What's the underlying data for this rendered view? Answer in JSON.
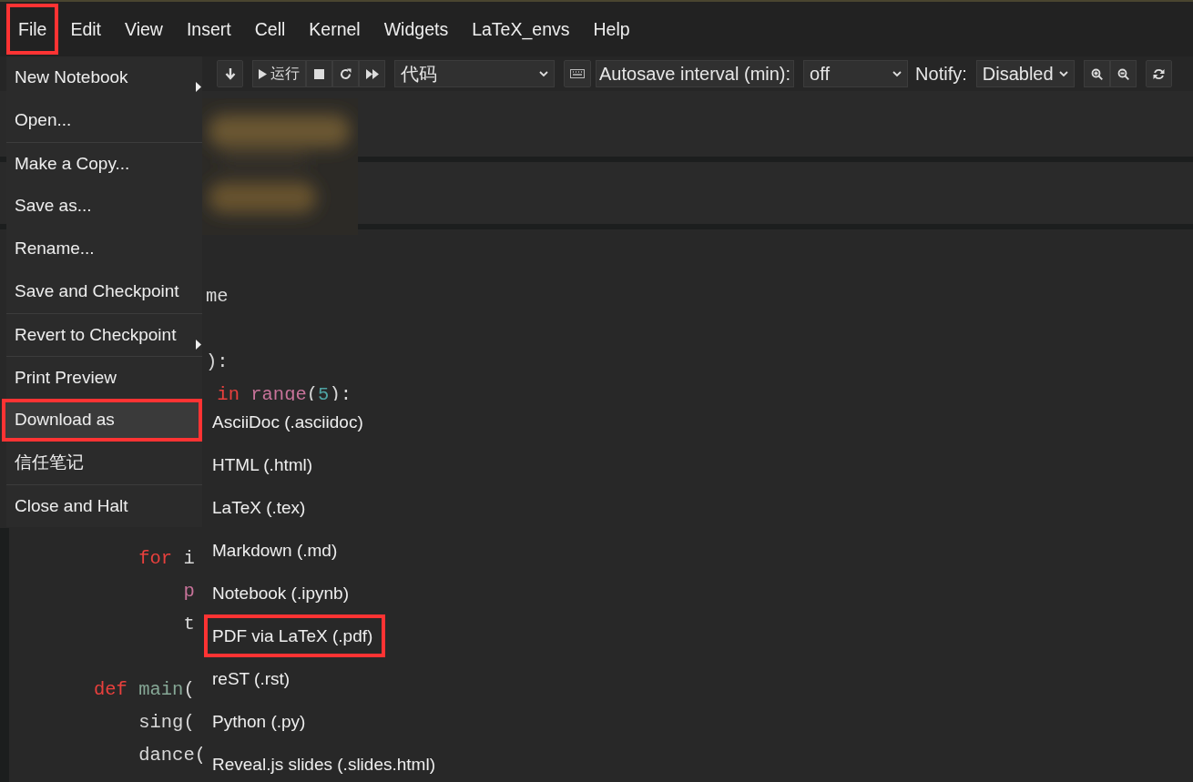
{
  "menubar": {
    "items": [
      {
        "label": "File",
        "highlighted": true
      },
      {
        "label": "Edit",
        "highlighted": false
      },
      {
        "label": "View",
        "highlighted": false
      },
      {
        "label": "Insert",
        "highlighted": false
      },
      {
        "label": "Cell",
        "highlighted": false
      },
      {
        "label": "Kernel",
        "highlighted": false
      },
      {
        "label": "Widgets",
        "highlighted": false
      },
      {
        "label": "LaTeX_envs",
        "highlighted": false
      },
      {
        "label": "Help",
        "highlighted": false
      }
    ]
  },
  "toolbar": {
    "run_label": "运行",
    "cell_type": "代码",
    "autosave_label": "Autosave interval (min):",
    "autosave_value": "off",
    "notify_label": "Notify:",
    "notify_value": "Disabled"
  },
  "code_lines": [
    {
      "kind": "code",
      "tokens": [
        {
          "kind": "plain",
          "text": "          me"
        }
      ]
    },
    {
      "kind": "blank"
    },
    {
      "kind": "code",
      "tokens": [
        {
          "kind": "plain",
          "text": "          ):"
        }
      ]
    },
    {
      "kind": "code",
      "tokens": [
        {
          "kind": "keyword",
          "text": "           in "
        },
        {
          "kind": "builtin",
          "text": "range"
        },
        {
          "kind": "plain",
          "text": "("
        },
        {
          "kind": "number",
          "text": "5"
        },
        {
          "kind": "plain",
          "text": "):"
        }
      ]
    },
    {
      "kind": "blank"
    },
    {
      "kind": "blank"
    },
    {
      "kind": "blank"
    },
    {
      "kind": "blank"
    },
    {
      "kind": "code",
      "tokens": [
        {
          "kind": "keyword",
          "text": "    for"
        },
        {
          "kind": "plain",
          "text": " i"
        }
      ]
    },
    {
      "kind": "code",
      "tokens": [
        {
          "kind": "builtin",
          "text": "        p"
        }
      ]
    },
    {
      "kind": "code",
      "tokens": [
        {
          "kind": "plain",
          "text": "        t"
        }
      ]
    },
    {
      "kind": "blank"
    },
    {
      "kind": "code",
      "tokens": [
        {
          "kind": "keyword",
          "text": "def "
        },
        {
          "kind": "defname",
          "text": "main"
        },
        {
          "kind": "plain",
          "text": "("
        }
      ]
    },
    {
      "kind": "code",
      "tokens": [
        {
          "kind": "plain",
          "text": "    sing("
        }
      ]
    },
    {
      "kind": "code",
      "tokens": [
        {
          "kind": "plain",
          "text": "    dance("
        }
      ]
    }
  ],
  "file_menu": {
    "items": [
      {
        "label": "New Notebook",
        "arrow": true,
        "separator_before": false,
        "hovered": false,
        "highlighted": false
      },
      {
        "label": "Open...",
        "arrow": false,
        "separator_before": false,
        "hovered": false,
        "highlighted": false
      },
      {
        "label": "Make a Copy...",
        "arrow": false,
        "separator_before": true,
        "hovered": false,
        "highlighted": false
      },
      {
        "label": "Save as...",
        "arrow": false,
        "separator_before": false,
        "hovered": false,
        "highlighted": false
      },
      {
        "label": "Rename...",
        "arrow": false,
        "separator_before": false,
        "hovered": false,
        "highlighted": false
      },
      {
        "label": "Save and Checkpoint",
        "arrow": false,
        "separator_before": false,
        "hovered": false,
        "highlighted": false
      },
      {
        "label": "Revert to Checkpoint",
        "arrow": true,
        "separator_before": true,
        "hovered": false,
        "highlighted": false
      },
      {
        "label": "Print Preview",
        "arrow": false,
        "separator_before": true,
        "hovered": false,
        "highlighted": false
      },
      {
        "label": "Download as",
        "arrow": false,
        "separator_before": false,
        "hovered": true,
        "highlighted": true
      },
      {
        "label": "信任笔记",
        "arrow": false,
        "separator_before": false,
        "hovered": false,
        "highlighted": false
      },
      {
        "label": "Close and Halt",
        "arrow": false,
        "separator_before": true,
        "hovered": false,
        "highlighted": false
      }
    ]
  },
  "download_submenu": {
    "items": [
      {
        "label": "AsciiDoc (.asciidoc)",
        "highlighted": false
      },
      {
        "label": "HTML (.html)",
        "highlighted": false
      },
      {
        "label": "LaTeX (.tex)",
        "highlighted": false
      },
      {
        "label": "Markdown (.md)",
        "highlighted": false
      },
      {
        "label": "Notebook (.ipynb)",
        "highlighted": false
      },
      {
        "label": "PDF via LaTeX (.pdf)",
        "highlighted": true
      },
      {
        "label": "reST (.rst)",
        "highlighted": false
      },
      {
        "label": "Python (.py)",
        "highlighted": false
      },
      {
        "label": "Reveal.js slides (.slides.html)",
        "highlighted": false
      }
    ]
  }
}
